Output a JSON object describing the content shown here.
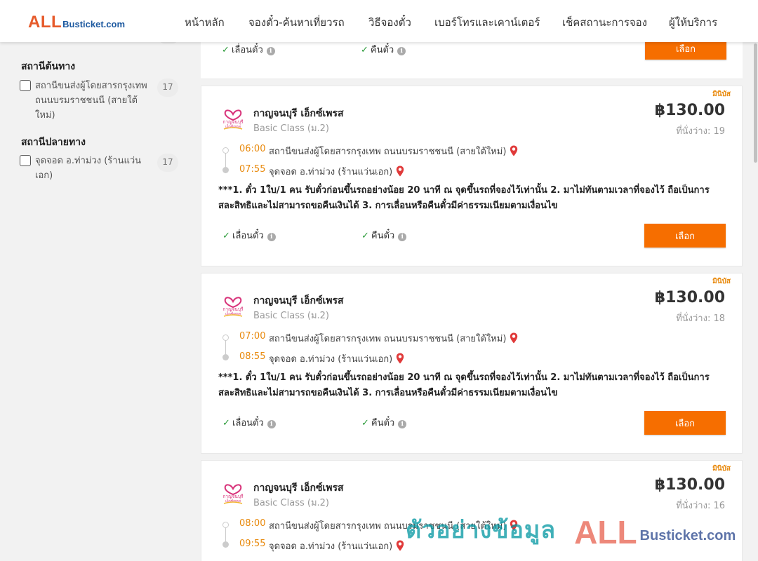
{
  "logo": {
    "main": "ALL",
    "suffix": "Busticket.com"
  },
  "nav": [
    {
      "label": "หน้าหลัก"
    },
    {
      "label": "จองตั๋ว-ค้นหาเที่ยวรถ"
    },
    {
      "label": "วิธีจองตั๋ว"
    },
    {
      "label": "เบอร์โทรและเคาน์เตอร์"
    },
    {
      "label": "เช็คสถานะการจอง"
    },
    {
      "label": "ผู้ให้บริการ"
    }
  ],
  "sidebar": {
    "origin_heading": "สถานีต้นทาง",
    "origin_options": [
      {
        "label": "สถานีขนส่งผู้โดยสารกรุงเทพ ถนนบรมราชชนนี (สายใต้ใหม่)",
        "count": "17"
      }
    ],
    "destination_heading": "สถานีปลายทาง",
    "destination_options": [
      {
        "label": "จุดจอด อ.ท่าม่วง (ร้านแว่นเอก)",
        "count": "17"
      }
    ]
  },
  "top_card": {
    "features": [
      "เลื่อนตั๋ว",
      "คืนตั๋ว"
    ],
    "button": "เลือก"
  },
  "trips": [
    {
      "tag": "มินิบัส",
      "operator": "กาญจนบุรี เอ็กซ์เพรส",
      "class": "Basic Class (ม.2)",
      "price": "฿130.00",
      "seats": "ที่นั่งว่าง: 19",
      "depart_time": "06:00",
      "depart_stop": "สถานีขนส่งผู้โดยสารกรุงเทพ ถนนบรมราชชนนี (สายใต้ใหม่)",
      "arrive_time": "07:55",
      "arrive_stop": "จุดจอด อ.ท่าม่วง (ร้านแว่นเอก)",
      "terms": "***1. ตั๋ว 1ใบ/1 คน รับตั๋วก่อนขึ้นรถอย่างน้อย 20 นาที ณ จุดขึ้นรถที่จองไว้เท่านั้น 2. มาไม่ทันตามเวลาที่จองไว้ ถือเป็นการสละสิทธิและไม่สามารถขอคืนเงินได้ 3. การเลื่อนหรือคืนตั๋วมีค่าธรรมเนียมตามเงื่อนไข",
      "feature_1": "เลื่อนตั๋ว",
      "feature_2": "คืนตั๋ว",
      "button": "เลือก"
    },
    {
      "tag": "มินิบัส",
      "operator": "กาญจนบุรี เอ็กซ์เพรส",
      "class": "Basic Class (ม.2)",
      "price": "฿130.00",
      "seats": "ที่นั่งว่าง: 18",
      "depart_time": "07:00",
      "depart_stop": "สถานีขนส่งผู้โดยสารกรุงเทพ ถนนบรมราชชนนี (สายใต้ใหม่)",
      "arrive_time": "08:55",
      "arrive_stop": "จุดจอด อ.ท่าม่วง (ร้านแว่นเอก)",
      "terms": "***1. ตั๋ว 1ใบ/1 คน รับตั๋วก่อนขึ้นรถอย่างน้อย 20 นาที ณ จุดขึ้นรถที่จองไว้เท่านั้น 2. มาไม่ทันตามเวลาที่จองไว้ ถือเป็นการสละสิทธิและไม่สามารถขอคืนเงินได้ 3. การเลื่อนหรือคืนตั๋วมีค่าธรรมเนียมตามเงื่อนไข",
      "feature_1": "เลื่อนตั๋ว",
      "feature_2": "คืนตั๋ว",
      "button": "เลือก"
    },
    {
      "tag": "มินิบัส",
      "operator": "กาญจนบุรี เอ็กซ์เพรส",
      "class": "Basic Class (ม.2)",
      "price": "฿130.00",
      "seats": "ที่นั่งว่าง: 16",
      "depart_time": "08:00",
      "depart_stop": "สถานีขนส่งผู้โดยสารกรุงเทพ ถนนบรมราชชนนี (สายใต้ใหม่)",
      "arrive_time": "09:55",
      "arrive_stop": "จุดจอด อ.ท่าม่วง (ร้านแว่นเอก)"
    }
  ],
  "operator_logo_text": "กาญจนบุรี เอ็กซ์เพรส",
  "watermark": {
    "thai": "ตัวอย่างข้อมูล",
    "all": "ALL",
    "rest": "Busticket.com"
  },
  "colors": {
    "accent": "#f66e00",
    "time": "#e8890c",
    "check": "#2e9c3c",
    "pin": "#e03a3a"
  }
}
